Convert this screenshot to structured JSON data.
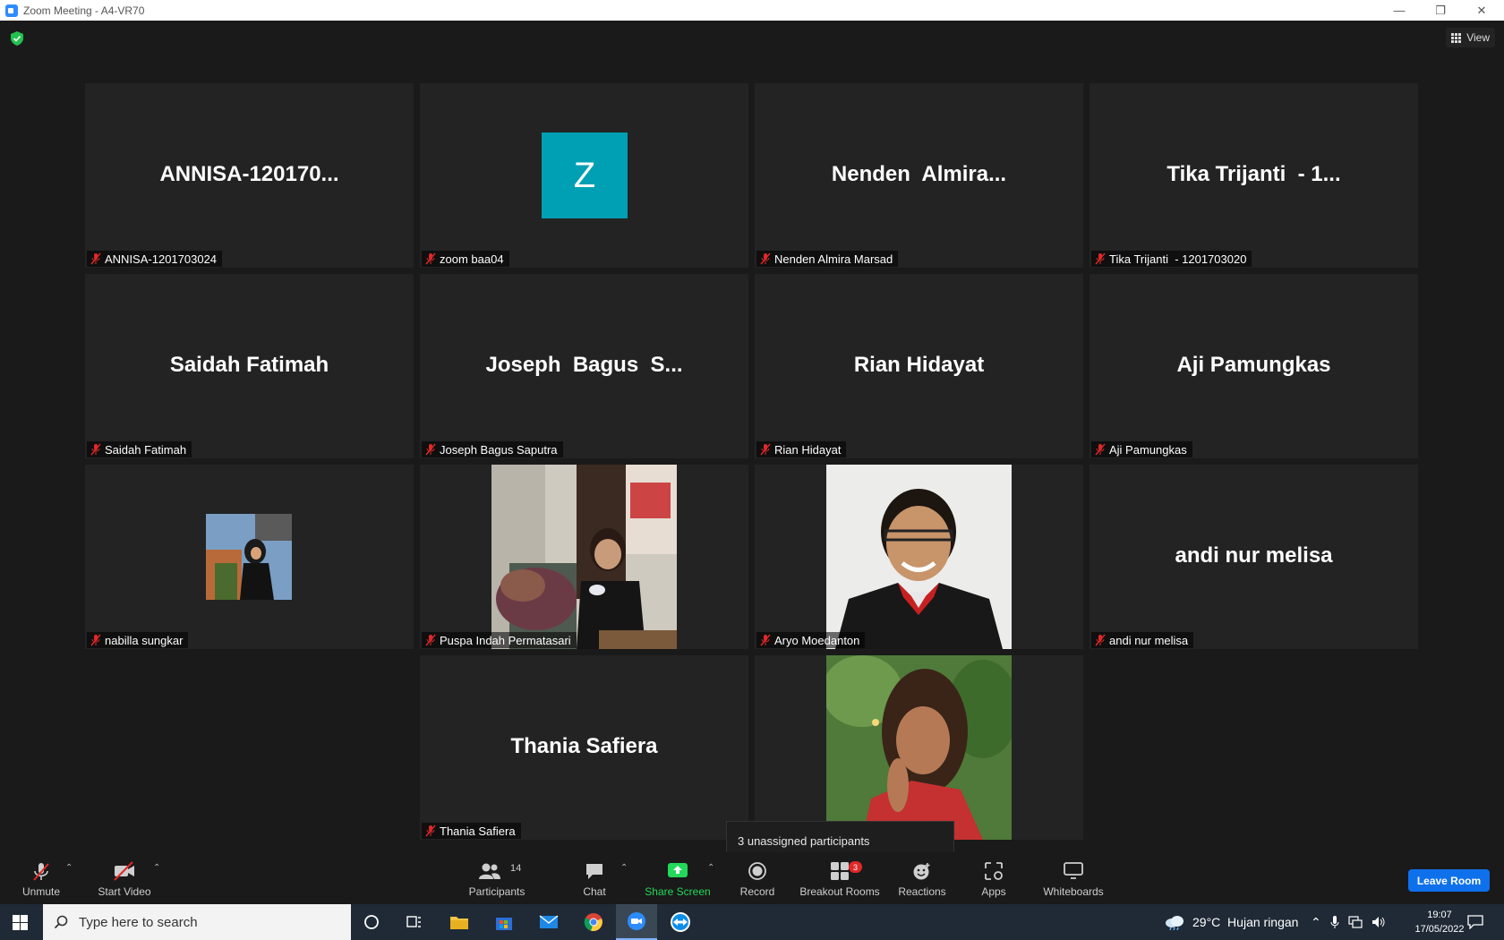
{
  "window": {
    "title": "Zoom Meeting - A4-VR70"
  },
  "view_button": {
    "label": "View"
  },
  "tiles": [
    {
      "big": "ANNISA-120170...",
      "label": "ANNISA-1201703024",
      "kind": "name"
    },
    {
      "big": "Z",
      "label": "zoom baa04",
      "kind": "avatar"
    },
    {
      "big": "Nenden  Almira...",
      "label": "Nenden Almira Marsad",
      "kind": "name"
    },
    {
      "big": "Tika Trijanti  - 1...",
      "label": "Tika Trijanti  - 1201703020",
      "kind": "name"
    },
    {
      "big": "Saidah Fatimah",
      "label": "Saidah Fatimah",
      "kind": "name"
    },
    {
      "big": "Joseph  Bagus  S...",
      "label": "Joseph Bagus Saputra",
      "kind": "name"
    },
    {
      "big": "Rian Hidayat",
      "label": "Rian Hidayat",
      "kind": "name"
    },
    {
      "big": "Aji Pamungkas",
      "label": "Aji Pamungkas",
      "kind": "name"
    },
    {
      "big": "",
      "label": "nabilla sungkar",
      "kind": "small-photo"
    },
    {
      "big": "",
      "label": "Puspa Indah Permatasari",
      "kind": "photo"
    },
    {
      "big": "",
      "label": "Aryo Moedanton",
      "kind": "photo"
    },
    {
      "big": "andi nur melisa",
      "label": "andi nur melisa",
      "kind": "name"
    },
    {
      "big": "Thania Safiera",
      "label": "Thania Safiera",
      "kind": "name"
    },
    {
      "big": "",
      "label": "",
      "kind": "photo"
    }
  ],
  "tooltip": {
    "text": "3 unassigned participants"
  },
  "toolbar": {
    "unmute": "Unmute",
    "start_video": "Start Video",
    "participants": "Participants",
    "participants_count": "14",
    "chat": "Chat",
    "share_screen": "Share Screen",
    "record": "Record",
    "breakout_rooms": "Breakout Rooms",
    "breakout_badge": "3",
    "reactions": "Reactions",
    "apps": "Apps",
    "whiteboards": "Whiteboards",
    "leave": "Leave Room"
  },
  "taskbar": {
    "search_placeholder": "Type here to search",
    "weather": "29°C  Hujan ringan",
    "time": "19:07",
    "date": "17/05/2022"
  },
  "colors": {
    "accent": "#0e71eb",
    "share_green": "#23d959",
    "mute_red": "#e02828",
    "avatar_teal": "#00a0b4"
  }
}
